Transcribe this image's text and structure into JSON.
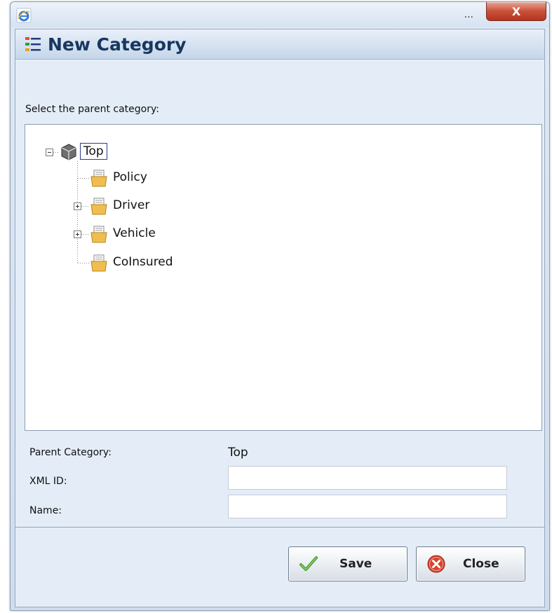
{
  "window": {
    "title_text": "...",
    "close_glyph": "X"
  },
  "dialog": {
    "title": "New Category",
    "prompt": "Select the parent category:"
  },
  "tree": {
    "root": {
      "label": "Top",
      "expanded": true,
      "selected": true,
      "icon": "package-icon"
    },
    "children": [
      {
        "label": "Policy",
        "expandable": false,
        "icon": "folder-document-icon"
      },
      {
        "label": "Driver",
        "expandable": true,
        "icon": "folder-document-icon"
      },
      {
        "label": "Vehicle",
        "expandable": true,
        "icon": "folder-document-icon"
      },
      {
        "label": "CoInsured",
        "expandable": false,
        "icon": "folder-document-icon"
      }
    ]
  },
  "fields": {
    "parent_category_label": "Parent Category:",
    "parent_category_value": "Top",
    "xml_id_label": "XML ID:",
    "xml_id_value": "",
    "name_label": "Name:",
    "name_value": ""
  },
  "buttons": {
    "save_label": "Save",
    "close_label": "Close"
  },
  "colors": {
    "title_text": "#17375e",
    "close_button": "#c9513a",
    "selection_border": "#2b3b8c"
  }
}
